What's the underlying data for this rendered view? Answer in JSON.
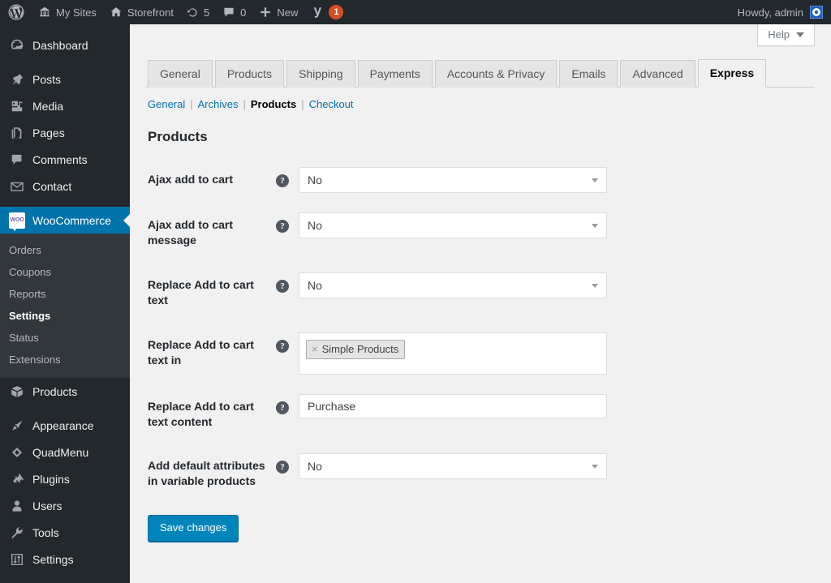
{
  "adminbar": {
    "logo_icon": "wordpress-logo-icon",
    "items": [
      {
        "icon": "my-sites-icon",
        "label": "My Sites"
      },
      {
        "icon": "home-icon",
        "label": "Storefront"
      },
      {
        "icon": "updates-icon",
        "label": "5"
      },
      {
        "icon": "comment-icon",
        "label": "0"
      },
      {
        "icon": "plus-icon",
        "label": "New"
      },
      {
        "icon": "yoast-seo-icon",
        "label": "1"
      }
    ],
    "howdy": "Howdy, admin",
    "avatar_name": "admin-avatar"
  },
  "sidebar": {
    "items": [
      {
        "label": "Dashboard",
        "icon": "dashboard-icon",
        "current": false
      },
      {
        "label": "Posts",
        "icon": "pin-icon",
        "current": false
      },
      {
        "label": "Media",
        "icon": "media-icon",
        "current": false
      },
      {
        "label": "Pages",
        "icon": "pages-icon",
        "current": false
      },
      {
        "label": "Comments",
        "icon": "comments-icon",
        "current": false
      },
      {
        "label": "Contact",
        "icon": "envelope-icon",
        "current": false
      },
      {
        "label": "WooCommerce",
        "icon": "woocommerce-icon",
        "current": true
      },
      {
        "label": "Products",
        "icon": "products-box-icon",
        "current": false
      },
      {
        "label": "Appearance",
        "icon": "appearance-brush-icon",
        "current": false
      },
      {
        "label": "QuadMenu",
        "icon": "quadmenu-icon",
        "current": false
      },
      {
        "label": "Plugins",
        "icon": "plugins-plug-icon",
        "current": false
      },
      {
        "label": "Users",
        "icon": "users-icon",
        "current": false
      },
      {
        "label": "Tools",
        "icon": "tools-wrench-icon",
        "current": false
      },
      {
        "label": "Settings",
        "icon": "settings-sliders-icon",
        "current": false
      }
    ],
    "woo_badge_text": "WOO",
    "submenu": [
      {
        "label": "Orders",
        "current": false
      },
      {
        "label": "Coupons",
        "current": false
      },
      {
        "label": "Reports",
        "current": false
      },
      {
        "label": "Settings",
        "current": true
      },
      {
        "label": "Status",
        "current": false
      },
      {
        "label": "Extensions",
        "current": false
      }
    ]
  },
  "help": {
    "label": "Help"
  },
  "tabs": [
    {
      "label": "General",
      "active": false
    },
    {
      "label": "Products",
      "active": false
    },
    {
      "label": "Shipping",
      "active": false
    },
    {
      "label": "Payments",
      "active": false
    },
    {
      "label": "Accounts & Privacy",
      "active": false
    },
    {
      "label": "Emails",
      "active": false
    },
    {
      "label": "Advanced",
      "active": false
    },
    {
      "label": "Express",
      "active": true
    }
  ],
  "subnav": [
    {
      "label": "General",
      "current": false
    },
    {
      "label": "Archives",
      "current": false
    },
    {
      "label": "Products",
      "current": true
    },
    {
      "label": "Checkout",
      "current": false
    }
  ],
  "subnav_separator": "|",
  "section_title": "Products",
  "fields": [
    {
      "label": "Ajax add to cart",
      "type": "select",
      "value": "No",
      "tip": "?",
      "name": "ajax-add-to-cart"
    },
    {
      "label": "Ajax add to cart message",
      "type": "select",
      "value": "No",
      "tip": "?",
      "name": "ajax-add-to-cart-message"
    },
    {
      "label": "Replace Add to cart text",
      "type": "select",
      "value": "No",
      "tip": "?",
      "name": "replace-add-to-cart-text"
    },
    {
      "label": "Replace Add to cart text in",
      "type": "tokens",
      "tokens": [
        "Simple Products"
      ],
      "token_remove": "×",
      "tip": "?",
      "name": "replace-add-to-cart-text-in"
    },
    {
      "label": "Replace Add to cart text content",
      "type": "text",
      "value": "Purchase",
      "placeholder": "",
      "tip": "?",
      "name": "replace-add-to-cart-text-content"
    },
    {
      "label": "Add default attributes in variable products",
      "type": "select",
      "value": "No",
      "tip": "?",
      "name": "add-default-attributes-in-variable-products"
    }
  ],
  "save_button": "Save changes",
  "colors": {
    "admin_bar": "#23282d",
    "sidebar": "#23282d",
    "submenu": "#32373c",
    "accent": "#0073aa",
    "button": "#0085ba",
    "badge": "#d54e21",
    "page_bg": "#f1f1f1",
    "link": "#0073aa"
  }
}
